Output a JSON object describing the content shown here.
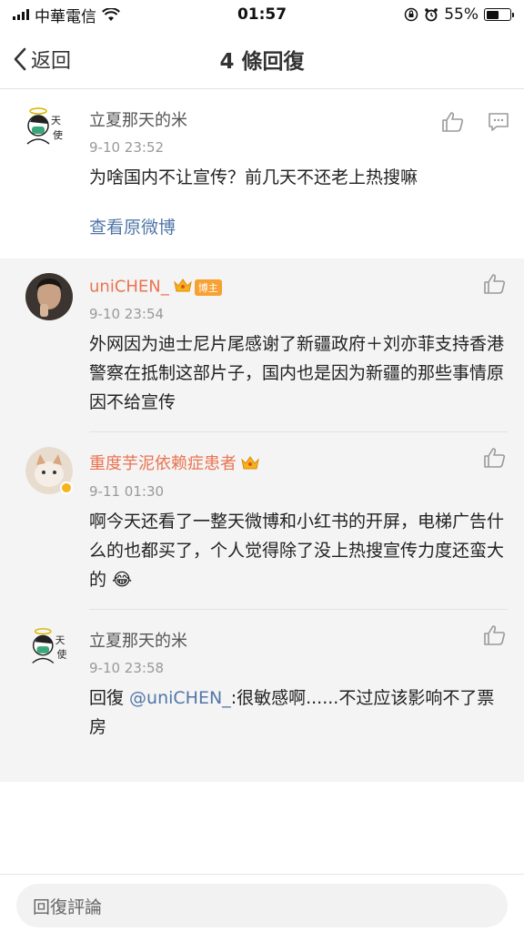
{
  "status": {
    "carrier": "中華電信",
    "time": "01:57",
    "battery": "55%",
    "battery_level": 0.55
  },
  "nav": {
    "back_label": "返回",
    "title": "4 條回復"
  },
  "main_comment": {
    "username": "立夏那天的米",
    "time": "9-10 23:52",
    "text": "为啥国内不让宣传？前几天不还老上热搜嘛",
    "link": "查看原微博"
  },
  "replies": [
    {
      "username": "uniCHEN_",
      "badge": "博主",
      "time": "9-10 23:54",
      "text": "外网因为迪士尼片尾感谢了新疆政府＋刘亦菲支持香港警察在抵制这部片子，国内也是因为新疆的那些事情原因不给宣传"
    },
    {
      "username": "重度芋泥依赖症患者",
      "time": "9-11 01:30",
      "text": "啊今天还看了一整天微博和小红书的开屏，电梯广告什么的也都买了，个人觉得除了没上热搜宣传力度还蛮大的 😂"
    },
    {
      "username": "立夏那天的米",
      "time": "9-10 23:58",
      "text_prefix": "回復 ",
      "mention": "@uniCHEN_",
      "text_suffix": ":很敏感啊......不过应该影响不了票房"
    }
  ],
  "bottom": {
    "placeholder": "回復評論"
  }
}
